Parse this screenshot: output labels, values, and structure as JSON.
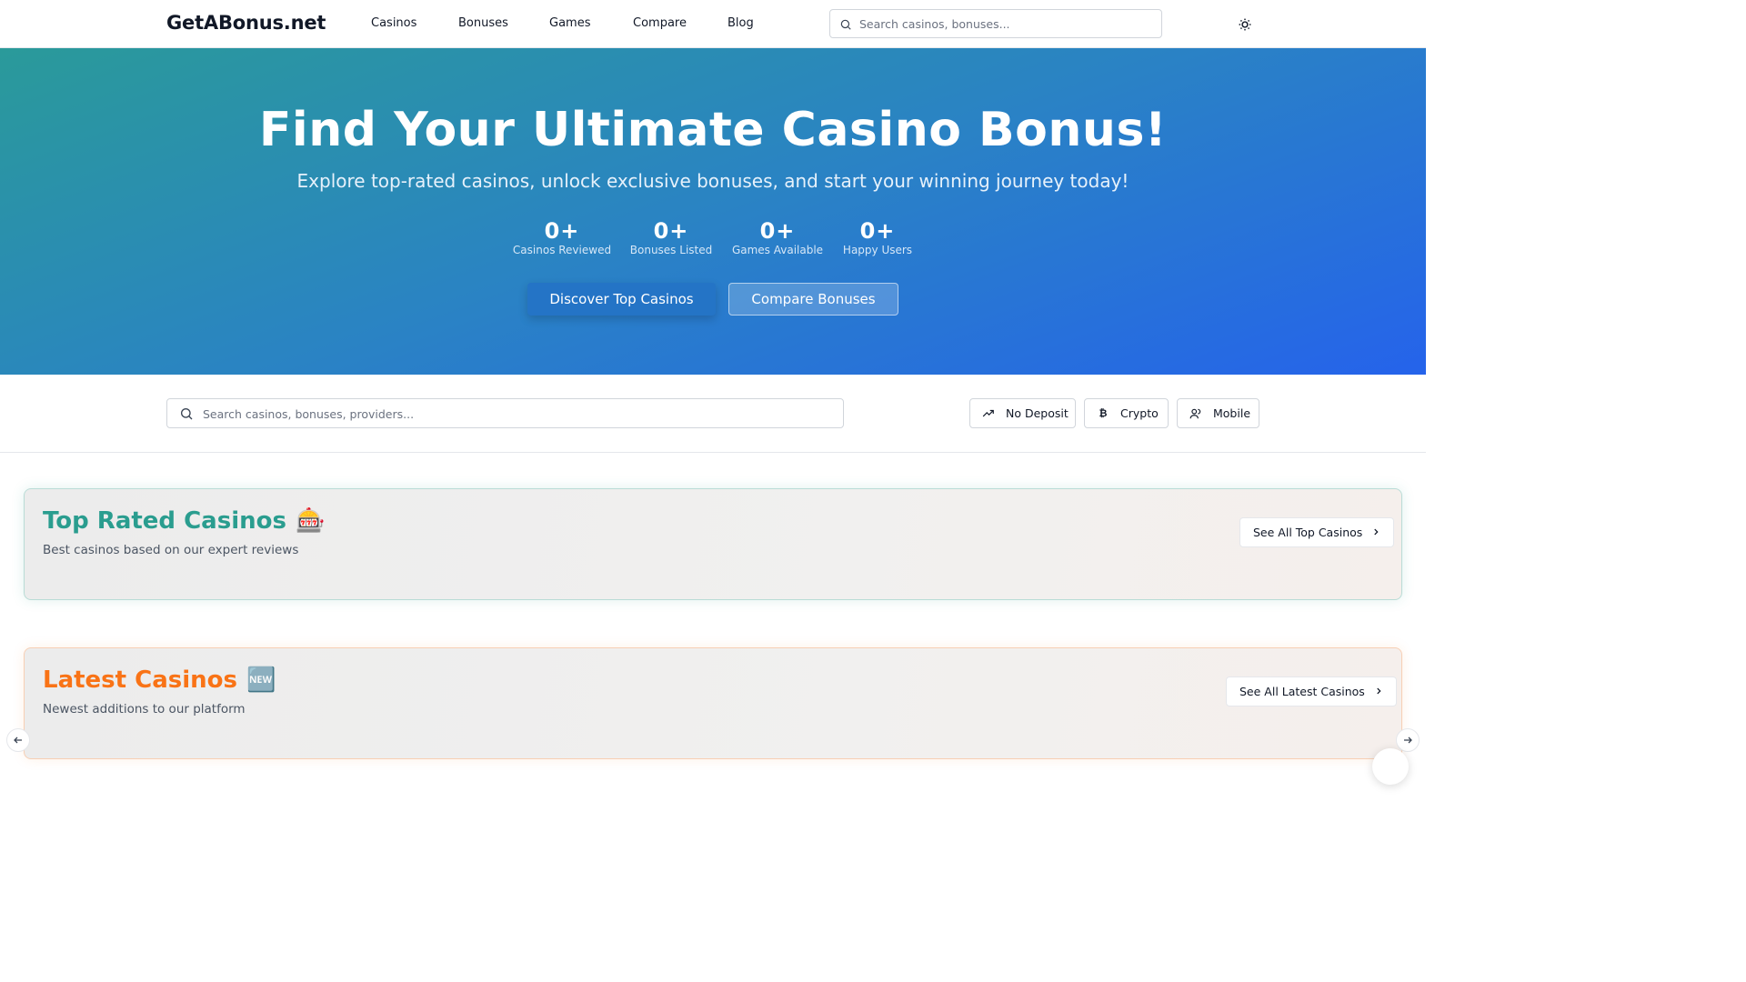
{
  "header": {
    "logo": "GetABonus.net",
    "nav": [
      "Casinos",
      "Bonuses",
      "Games",
      "Compare",
      "Blog"
    ],
    "search_placeholder": "Search casinos, bonuses...",
    "theme_icon": "sun-icon"
  },
  "hero": {
    "title": "Find Your Ultimate Casino Bonus!",
    "subtitle": "Explore top-rated casinos, unlock exclusive bonuses, and start your winning journey today!",
    "stats": [
      {
        "value": "0+",
        "label": "Casinos Reviewed"
      },
      {
        "value": "0+",
        "label": "Bonuses Listed"
      },
      {
        "value": "0+",
        "label": "Games Available"
      },
      {
        "value": "0+",
        "label": "Happy Users"
      }
    ],
    "primary_button": "Discover Top Casinos",
    "secondary_button": "Compare Bonuses"
  },
  "filters": {
    "search_placeholder": "Search casinos, bonuses, providers...",
    "chips": [
      {
        "label": "No Deposit",
        "icon": "trending-up-icon"
      },
      {
        "label": "Crypto",
        "icon": "bitcoin-icon"
      },
      {
        "label": "Mobile",
        "icon": "users-icon"
      }
    ]
  },
  "sections": {
    "top_rated": {
      "title": "Top Rated Casinos",
      "emoji": "🎰",
      "subtitle": "Best casinos based on our expert reviews",
      "button": "See All Top Casinos",
      "accent": "#2a9d8f"
    },
    "latest": {
      "title": "Latest Casinos",
      "emoji": "🆕",
      "subtitle": "Newest additions to our platform",
      "button": "See All Latest Casinos",
      "accent": "#f97316"
    }
  },
  "colors": {
    "hero_gradient_start": "#2a9a9a",
    "hero_gradient_end": "#2563eb",
    "primary_button": "#2474c6"
  }
}
